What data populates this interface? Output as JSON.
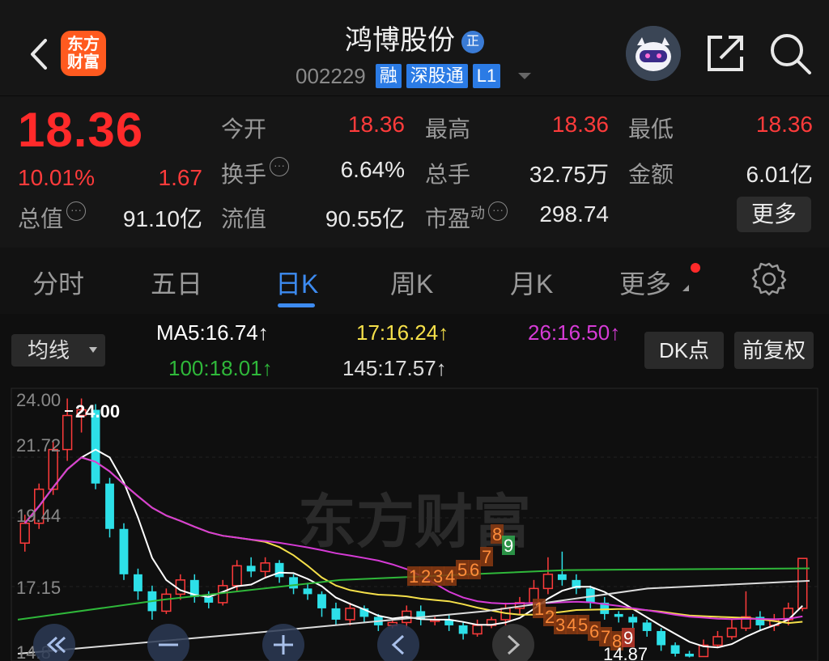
{
  "header": {
    "back_icon": "chevron-left-icon",
    "logo_text_line1": "东方",
    "logo_text_line2": "财富",
    "stock_name": "鸿博股份",
    "badge": "正",
    "code": "002229",
    "tags": [
      "融",
      "深股通",
      "L1"
    ],
    "share_icon": "share-icon",
    "search_icon": "search-icon"
  },
  "quote": {
    "price": "18.36",
    "change_pct": "10.01%",
    "change": "1.67",
    "fields": [
      {
        "label": "今开",
        "value": "18.36",
        "color": "#ff3b3b"
      },
      {
        "label": "最高",
        "value": "18.36",
        "color": "#ff3b3b"
      },
      {
        "label": "最低",
        "value": "18.36",
        "color": "#ff3b3b"
      },
      {
        "label": "换手",
        "value": "6.64%",
        "color": "#eaeaea"
      },
      {
        "label": "总手",
        "value": "32.75万",
        "color": "#eaeaea"
      },
      {
        "label": "金额",
        "value": "6.01亿",
        "color": "#eaeaea"
      },
      {
        "label": "总值",
        "value": "91.10亿",
        "color": "#eaeaea"
      },
      {
        "label": "流值",
        "value": "90.55亿",
        "color": "#eaeaea"
      },
      {
        "label": "市盈",
        "value": "298.74",
        "color": "#eaeaea"
      }
    ],
    "pe_superscript": "动",
    "more_label": "更多"
  },
  "tabs": [
    {
      "label": "分时"
    },
    {
      "label": "五日"
    },
    {
      "label": "日K"
    },
    {
      "label": "周K"
    },
    {
      "label": "月K"
    },
    {
      "label": "更多"
    }
  ],
  "active_tab": "日K",
  "indicators": {
    "select_label": "均线",
    "ma5": "MA5:16.74↑",
    "ma17": "17:16.24↑",
    "ma26": "26:16.50↑",
    "ma100": "100:18.01↑",
    "ma145": "145:17.57↑",
    "dk_label": "DK点",
    "fq_label": "前复权",
    "colors": {
      "ma5": "#ffffff",
      "ma17": "#f5e04a",
      "ma26": "#d63bd6",
      "ma100": "#2fb83a",
      "ma145": "#dcdcdc"
    }
  },
  "chart_data": {
    "type": "candlestick",
    "y_tick_labels": [
      "24.00",
      "21.72",
      "19.44",
      "17.15",
      "14.8"
    ],
    "max_marker": "24.00",
    "min_marker": "14.87",
    "watermark": "东方财富",
    "ylim": [
      14.8,
      24.3
    ],
    "up_color": "#ff3b3b",
    "down_color": "#2de0e8",
    "candles": [
      [
        18.9,
        19.6,
        19.9,
        18.6
      ],
      [
        19.6,
        20.8,
        21.0,
        19.4
      ],
      [
        20.8,
        22.2,
        22.5,
        20.6
      ],
      [
        22.2,
        23.4,
        24.0,
        21.8
      ],
      [
        23.4,
        23.6,
        24.0,
        22.8
      ],
      [
        23.6,
        21.0,
        23.8,
        20.8
      ],
      [
        21.0,
        19.4,
        21.2,
        19.1
      ],
      [
        19.4,
        17.8,
        19.6,
        17.6
      ],
      [
        17.8,
        17.2,
        18.0,
        16.9
      ],
      [
        17.2,
        16.5,
        17.4,
        16.2
      ],
      [
        16.5,
        17.1,
        17.3,
        16.4
      ],
      [
        17.1,
        17.6,
        17.8,
        16.9
      ],
      [
        17.6,
        17.0,
        17.8,
        16.8
      ],
      [
        17.0,
        16.8,
        17.2,
        16.6
      ],
      [
        16.8,
        17.4,
        17.6,
        16.7
      ],
      [
        17.4,
        18.1,
        18.3,
        17.2
      ],
      [
        18.1,
        17.9,
        18.4,
        17.7
      ],
      [
        17.9,
        18.2,
        18.4,
        17.7
      ],
      [
        18.2,
        17.7,
        18.3,
        17.5
      ],
      [
        17.7,
        17.3,
        17.8,
        17.1
      ],
      [
        17.3,
        17.1,
        17.5,
        16.9
      ],
      [
        17.1,
        16.6,
        17.2,
        16.3
      ],
      [
        16.6,
        16.2,
        16.8,
        16.0
      ],
      [
        16.2,
        16.6,
        16.8,
        16.0
      ],
      [
        16.6,
        16.3,
        16.7,
        16.1
      ],
      [
        16.3,
        16.0,
        16.4,
        15.8
      ],
      [
        16.0,
        16.1,
        16.2,
        15.9
      ],
      [
        16.1,
        16.5,
        16.7,
        15.9
      ],
      [
        16.5,
        16.2,
        16.7,
        16.0
      ],
      [
        16.2,
        16.2,
        16.3,
        16.0
      ],
      [
        16.2,
        16.0,
        16.4,
        15.8
      ],
      [
        16.0,
        15.7,
        16.1,
        15.5
      ],
      [
        15.7,
        16.0,
        16.2,
        15.6
      ],
      [
        16.0,
        16.2,
        16.3,
        15.9
      ],
      [
        16.2,
        16.6,
        16.8,
        16.0
      ],
      [
        16.6,
        16.8,
        17.0,
        16.4
      ],
      [
        16.8,
        17.3,
        17.6,
        16.7
      ],
      [
        17.3,
        17.8,
        18.4,
        17.1
      ],
      [
        17.8,
        17.6,
        18.6,
        17.4
      ],
      [
        17.6,
        17.3,
        17.8,
        17.1
      ],
      [
        17.3,
        16.8,
        17.4,
        16.6
      ],
      [
        16.8,
        16.4,
        17.0,
        16.2
      ],
      [
        16.4,
        16.3,
        16.5,
        16.1
      ],
      [
        16.3,
        16.1,
        16.4,
        15.9
      ],
      [
        16.1,
        15.8,
        16.2,
        15.6
      ],
      [
        15.8,
        15.3,
        15.9,
        15.1
      ],
      [
        15.3,
        15.0,
        15.4,
        14.9
      ],
      [
        15.0,
        14.9,
        15.1,
        14.87
      ],
      [
        14.9,
        15.3,
        15.5,
        14.9
      ],
      [
        15.3,
        15.6,
        15.8,
        15.2
      ],
      [
        15.6,
        15.9,
        16.2,
        15.5
      ],
      [
        15.9,
        16.3,
        17.2,
        15.8
      ],
      [
        16.3,
        16.0,
        16.5,
        15.8
      ],
      [
        16.0,
        16.2,
        16.4,
        15.8
      ],
      [
        16.2,
        16.6,
        16.8,
        16.0
      ],
      [
        16.6,
        18.36,
        18.36,
        16.5
      ]
    ],
    "dk_labels_top": [
      "1",
      "2",
      "3",
      "4",
      "5",
      "6",
      "7",
      "8",
      "9"
    ],
    "dk_labels_bottom": [
      "1",
      "2",
      "3",
      "4",
      "5",
      "6",
      "7",
      "8",
      "9"
    ]
  },
  "toolbar_icons": [
    "double-chevron-left-icon",
    "minus-icon",
    "plus-icon",
    "chevron-left-icon",
    "chevron-right-icon"
  ]
}
